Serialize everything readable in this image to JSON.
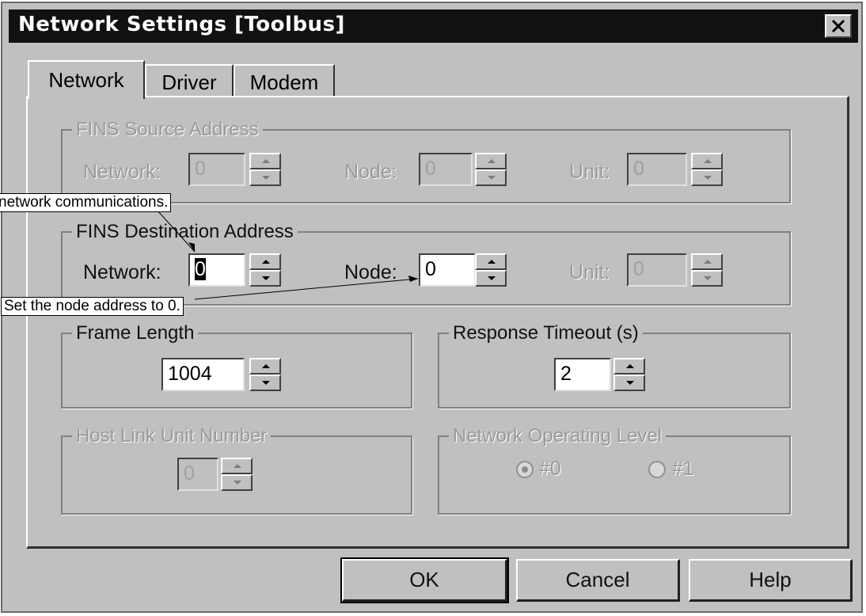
{
  "window": {
    "title": "Network Settings [Toolbus]"
  },
  "tabs": [
    {
      "label": "Network"
    },
    {
      "label": "Driver"
    },
    {
      "label": "Modem"
    }
  ],
  "source_address": {
    "legend": "FINS Source Address",
    "network_label": "Network:",
    "network_value": "0",
    "node_label": "Node:",
    "node_value": "0",
    "unit_label": "Unit:",
    "unit_value": "0"
  },
  "destination_address": {
    "legend": "FINS Destination Address",
    "network_label": "Network:",
    "network_value": "0",
    "node_label": "Node:",
    "node_value": "0",
    "unit_label": "Unit:",
    "unit_value": "0"
  },
  "frame_length": {
    "legend": "Frame Length",
    "value": "1004"
  },
  "response_timeout": {
    "legend": "Response Timeout (s)",
    "value": "2"
  },
  "host_link": {
    "legend": "Host Link Unit Number",
    "value": "0"
  },
  "operating_level": {
    "legend": "Network Operating Level",
    "options": [
      "#0",
      "#1"
    ],
    "selected": "#0"
  },
  "buttons": {
    "ok": "OK",
    "cancel": "Cancel",
    "help": "Help"
  },
  "annotations": {
    "network_comm": "network communications.",
    "node_address": "Set the node address to 0."
  },
  "colors": {
    "dialog_bg": "#c0c0c0",
    "titlebar_bg": "#111111",
    "disabled_text": "#9a9a9a"
  },
  "icons": {
    "close": "close-icon",
    "spin_up": "arrow-up-icon",
    "spin_down": "arrow-down-icon"
  }
}
